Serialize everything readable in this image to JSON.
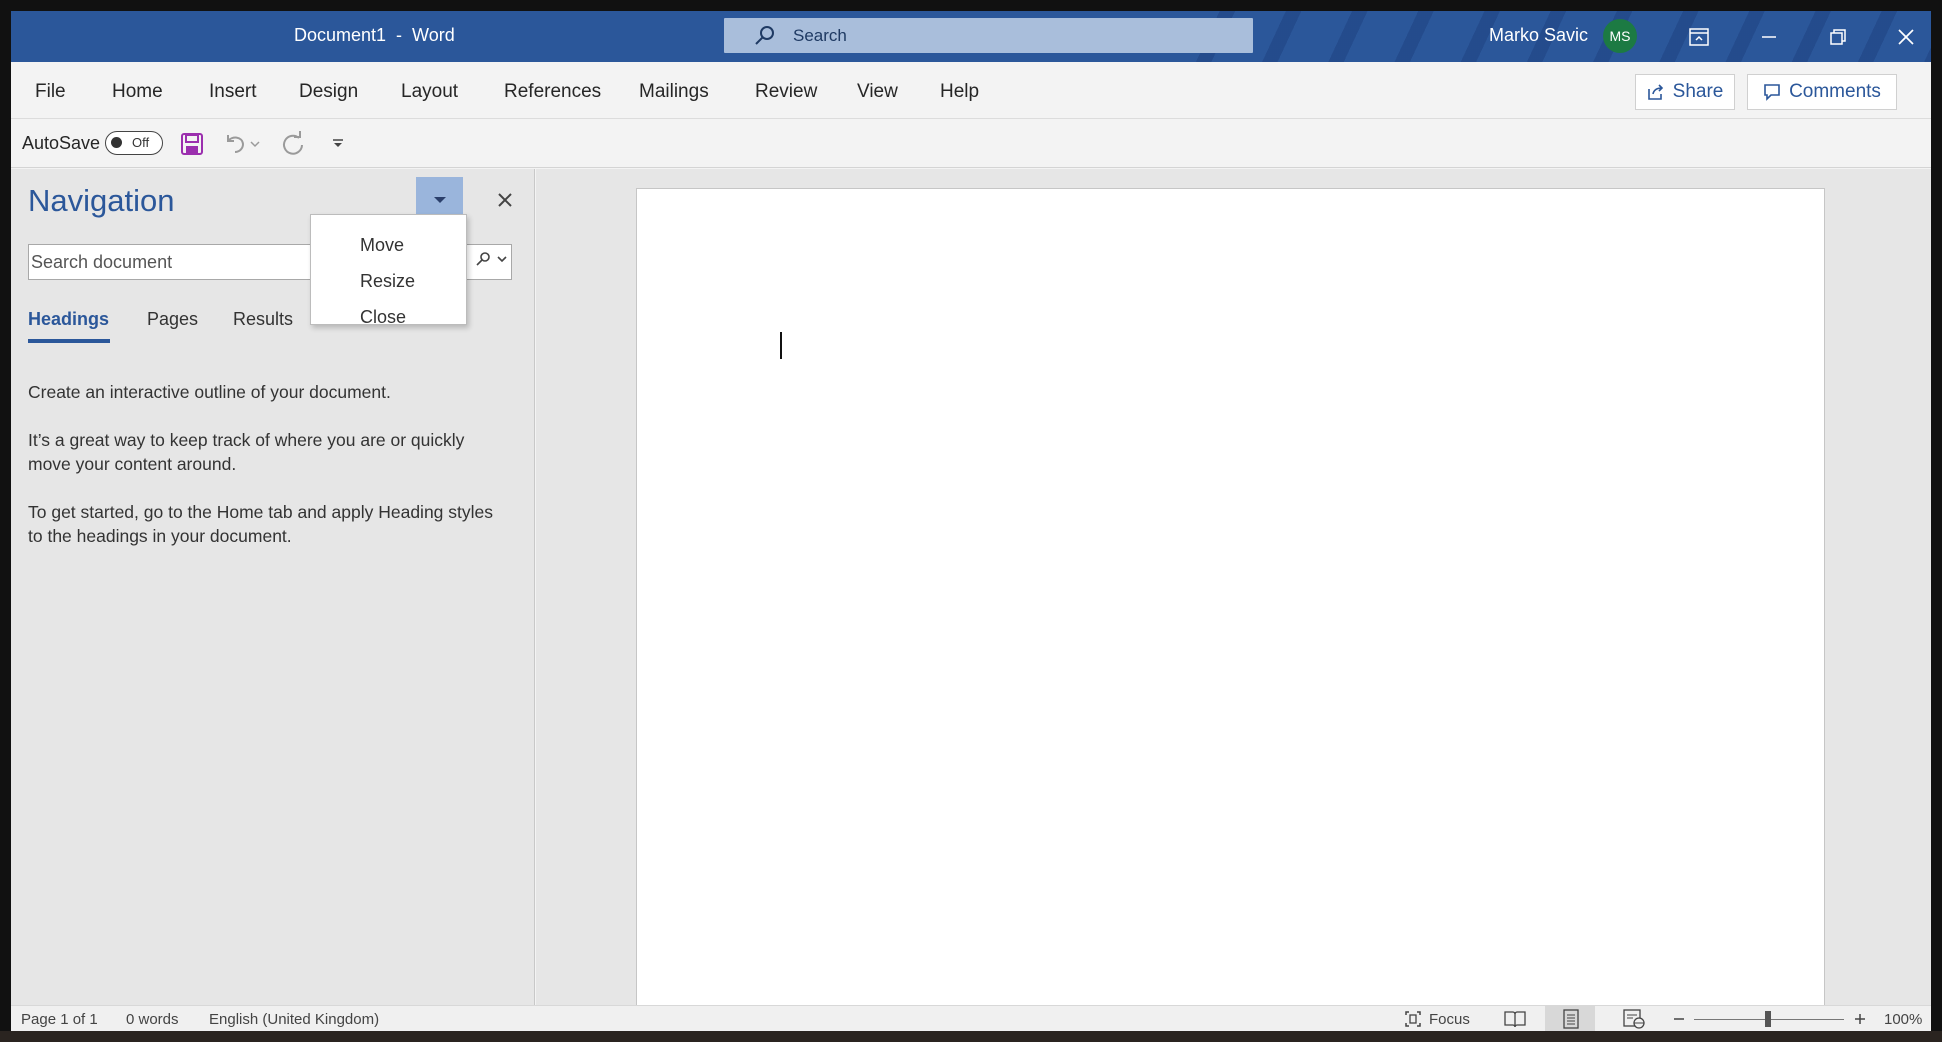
{
  "titlebar": {
    "doc_title": "Document1  -  Word",
    "search_label": "Search",
    "user_name": "Marko Savic",
    "avatar_initials": "MS"
  },
  "menu": {
    "tabs": [
      "File",
      "Home",
      "Insert",
      "Design",
      "Layout",
      "References",
      "Mailings",
      "Review",
      "View",
      "Help"
    ],
    "share_label": "Share",
    "comments_label": "Comments"
  },
  "qat": {
    "autosave_label": "AutoSave",
    "autosave_state": "Off"
  },
  "navigation": {
    "title": "Navigation",
    "search_placeholder": "Search document",
    "tabs": [
      "Headings",
      "Pages",
      "Results"
    ],
    "active_tab": "Headings",
    "help_paragraphs": [
      "Create an interactive outline of your document.",
      "It’s a great way to keep track of where you are or quickly",
      "move your content around.",
      "To get started, go to the Home tab and apply Heading styles",
      "to the headings in your document."
    ]
  },
  "popup_menu": {
    "items": [
      "Move",
      "Resize",
      "Close"
    ]
  },
  "statusbar": {
    "page": "Page 1 of 1",
    "words": "0 words",
    "language": "English (United Kingdom)",
    "focus_label": "Focus",
    "zoom": "100%"
  },
  "colors": {
    "accent": "#2b579a",
    "nav_bg": "#e6e6e6",
    "avatar": "#1c7a43"
  }
}
